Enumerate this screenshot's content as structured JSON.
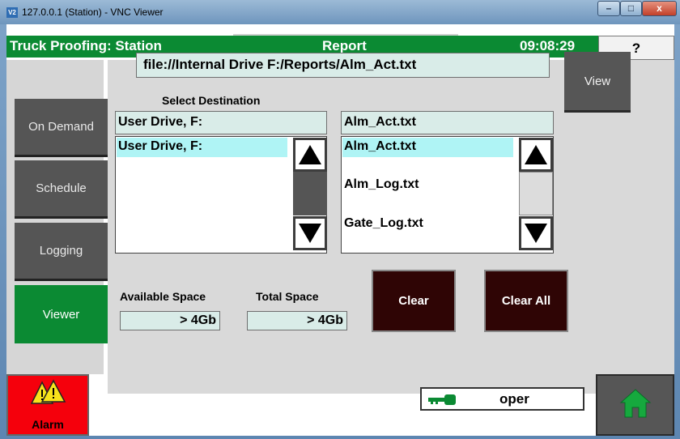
{
  "window": {
    "logo": "V2",
    "title": "127.0.0.1 (Station) - VNC Viewer",
    "controls": {
      "minimize": "–",
      "maximize": "□",
      "close": "x"
    }
  },
  "header": {
    "title": "Truck Proofing: Station",
    "section": "Report",
    "time": "09:08:29",
    "help_label": "?"
  },
  "nav": {
    "items": [
      {
        "label": "On Demand"
      },
      {
        "label": "Schedule"
      },
      {
        "label": "Logging"
      },
      {
        "label": "Viewer",
        "active": true
      }
    ]
  },
  "viewer": {
    "file_path": "file://Internal Drive F:/Reports/Alm_Act.txt",
    "view_label": "View",
    "select_destination_label": "Select Destination",
    "destination_selected": "User Drive, F:",
    "destinations": [
      "User Drive, F:"
    ],
    "file_selected": "Alm_Act.txt",
    "files": [
      "Alm_Act.txt",
      "Alm_Log.txt",
      "Gate_Log.txt"
    ],
    "available_space_label": "Available Space",
    "available_space_value": "> 4Gb",
    "total_space_label": "Total Space",
    "total_space_value": "> 4Gb",
    "clear_label": "Clear",
    "clear_all_label": "Clear All"
  },
  "footer": {
    "alarm_label": "Alarm",
    "user": "oper"
  },
  "colors": {
    "header_green": "#0b8a33",
    "alarm_red": "#f5000c",
    "selection_cyan": "#aff4f5",
    "dark_button": "#2f0505"
  }
}
